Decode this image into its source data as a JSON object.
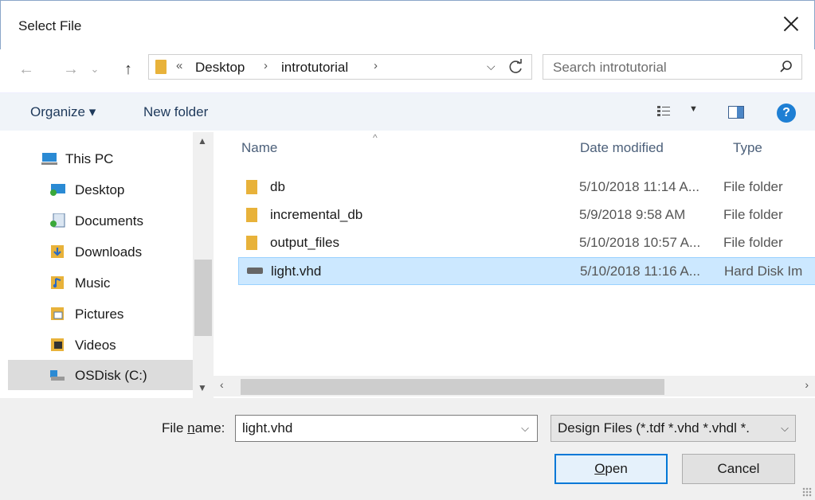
{
  "window": {
    "title": "Select File"
  },
  "address_bar": {
    "overflow": "«",
    "crumbs": [
      "Desktop",
      "introtutorial"
    ],
    "sep": "›"
  },
  "search": {
    "placeholder": "Search introtutorial"
  },
  "toolbar": {
    "organize": "Organize ▾",
    "new_folder": "New folder"
  },
  "nav": {
    "items": [
      {
        "label": "This PC",
        "icon": "pc-icon"
      },
      {
        "label": "Desktop",
        "icon": "desktop-icon"
      },
      {
        "label": "Documents",
        "icon": "documents-icon"
      },
      {
        "label": "Downloads",
        "icon": "downloads-icon"
      },
      {
        "label": "Music",
        "icon": "music-icon"
      },
      {
        "label": "Pictures",
        "icon": "pictures-icon"
      },
      {
        "label": "Videos",
        "icon": "videos-icon"
      },
      {
        "label": "OSDisk (C:)",
        "icon": "disk-icon"
      }
    ],
    "selected": "OSDisk (C:)"
  },
  "files": {
    "columns": [
      "Name",
      "Date modified",
      "Type"
    ],
    "rows": [
      {
        "name": "db",
        "date": "5/10/2018 11:14 A...",
        "type": "File folder",
        "icon": "folder-icon"
      },
      {
        "name": "incremental_db",
        "date": "5/9/2018 9:58 AM",
        "type": "File folder",
        "icon": "folder-icon"
      },
      {
        "name": "output_files",
        "date": "5/10/2018 10:57 A...",
        "type": "File folder",
        "icon": "folder-icon"
      },
      {
        "name": "light.vhd",
        "date": "5/10/2018 11:16 A...",
        "type": "Hard Disk Im",
        "icon": "hard-disk-image-icon"
      }
    ],
    "selected": "light.vhd"
  },
  "footer": {
    "file_name_label_pre": "File ",
    "file_name_label_u": "n",
    "file_name_label_post": "ame:",
    "file_name_value": "light.vhd",
    "filter_value": "Design Files (*.tdf *.vhd *.vhdl *.",
    "open_u": "O",
    "open_rest": "pen",
    "cancel": "Cancel"
  },
  "colors": {
    "accent": "#0078d7",
    "selection": "#cce8ff",
    "folder": "#e8b23a"
  }
}
